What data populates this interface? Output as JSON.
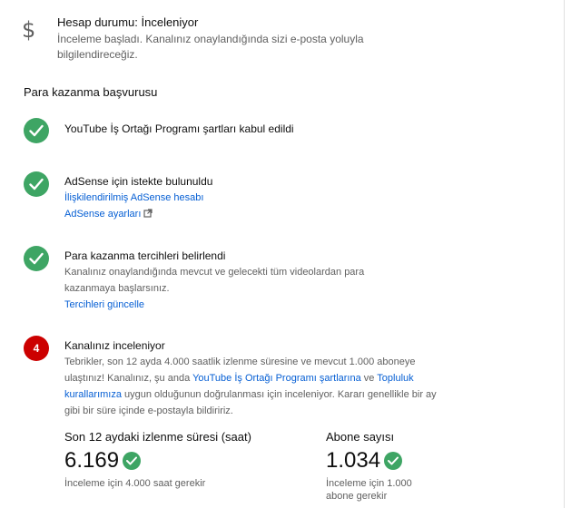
{
  "account_status": {
    "title": "Hesap durumu: İnceleniyor",
    "description": "İnceleme başladı. Kanalınız onaylandığında sizi e-posta yoluyla bilgilendireceğiz."
  },
  "monetization": {
    "section_title": "Para kazanma başvurusu",
    "steps": [
      {
        "title": "YouTube İş Ortağı Programı şartları kabul edildi",
        "state": "done"
      },
      {
        "title": "AdSense için istekte bulunuldu",
        "state": "done",
        "links": [
          "İlişkilendirilmiş AdSense hesabı",
          "AdSense ayarları"
        ]
      },
      {
        "title": "Para kazanma tercihleri belirlendi",
        "state": "done",
        "description": "Kanalınız onaylandığında mevcut ve gelecekti tüm videolardan para kazanmaya başlarsınız.",
        "link": "Tercihleri güncelle"
      },
      {
        "number": "4",
        "title": "Kanalınız inceleniyor",
        "state": "pending",
        "text_1": "Tebrikler, son 12 ayda 4.000 saatlik izlenme süresine ve mevcut 1.000 aboneye ulaştınız! Kanalınız, şu anda ",
        "link_1": "YouTube İş Ortağı Programı şartlarına",
        "text_2": " ve ",
        "link_2": "Topluluk kurallarımıza",
        "text_3": " uygun olduğunun doğrulanması için inceleniyor. Kararı genellikle bir ay gibi bir süre içinde e-postayla bildiririz."
      }
    ]
  },
  "metrics": {
    "watch_time": {
      "label": "Son 12 aydaki izlenme süresi (saat)",
      "value": "6.169",
      "note": "İnceleme için 4.000 saat gerekir"
    },
    "subscribers": {
      "label": "Abone sayısı",
      "value": "1.034",
      "note": "İnceleme için 1.000 abone gerekir"
    }
  },
  "colors": {
    "success": "#3ea564",
    "alert": "#cc0000",
    "link": "#065fd4",
    "secondary_text": "#606060"
  },
  "icons": {
    "status": "dollar-icon",
    "done": "check-circle-icon",
    "pending": "number-badge",
    "external": "external-link-icon"
  }
}
